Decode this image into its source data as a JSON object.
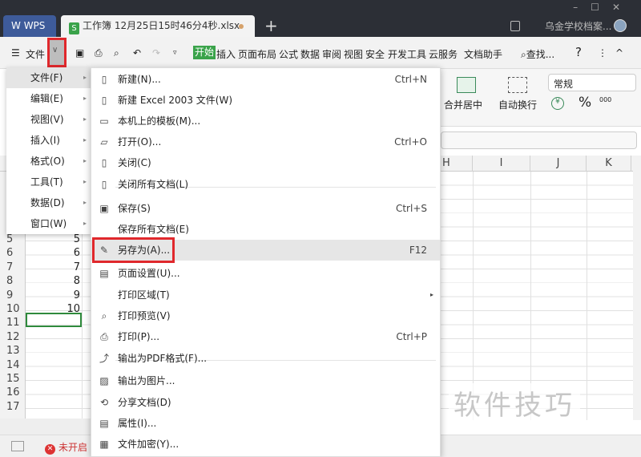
{
  "titlebar": {
    "wps_tab": "WPS",
    "doc_tab": "工作簿 12月25日15时46分4秒.xlsx",
    "doc_icon": "S",
    "user": "乌金学校档案...",
    "window_controls": [
      "–",
      "☐",
      "✕"
    ]
  },
  "toolbar": {
    "menu": "文件",
    "tabs": [
      "开始",
      "插入",
      "页面布局",
      "公式",
      "数据",
      "审阅",
      "视图",
      "安全",
      "开发工具",
      "云服务",
      "文档助手"
    ],
    "search": "查找...",
    "help": "?",
    "more": "⋮",
    "collapse": "^"
  },
  "ribbon": {
    "merge": "合并居中",
    "wrap": "自动换行",
    "format": "常规",
    "percent": "%",
    "thousands": "000"
  },
  "sheet": {
    "columns": [
      "H",
      "I",
      "J",
      "K"
    ],
    "rows": [
      "5",
      "6",
      "7",
      "8",
      "9",
      "10",
      "11",
      "12",
      "13",
      "14",
      "15",
      "16",
      "17"
    ],
    "values": [
      "5",
      "6",
      "7",
      "8",
      "9",
      "10"
    ]
  },
  "status": {
    "warning": "未开启"
  },
  "left_menu": [
    {
      "label": "文件(F)"
    },
    {
      "label": "编辑(E)"
    },
    {
      "label": "视图(V)"
    },
    {
      "label": "插入(I)"
    },
    {
      "label": "格式(O)"
    },
    {
      "label": "工具(T)"
    },
    {
      "label": "数据(D)"
    },
    {
      "label": "窗口(W)"
    }
  ],
  "file_menu": [
    {
      "label": "新建(N)...",
      "shortcut": "Ctrl+N",
      "icon": "new-file"
    },
    {
      "label": "新建 Excel 2003 文件(W)",
      "shortcut": "",
      "icon": "new-file"
    },
    {
      "label": "本机上的模板(M)...",
      "shortcut": "",
      "icon": "template"
    },
    {
      "label": "打开(O)...",
      "shortcut": "Ctrl+O",
      "icon": "folder"
    },
    {
      "label": "关闭(C)",
      "shortcut": "",
      "icon": "close-doc"
    },
    {
      "label": "关闭所有文档(L)",
      "shortcut": "",
      "icon": "close-all"
    },
    {
      "label": "保存(S)",
      "shortcut": "Ctrl+S",
      "icon": "save"
    },
    {
      "label": "保存所有文档(E)",
      "shortcut": "",
      "icon": ""
    },
    {
      "label": "另存为(A)...",
      "shortcut": "F12",
      "icon": "save-as"
    },
    {
      "label": "页面设置(U)...",
      "shortcut": "",
      "icon": "page-setup"
    },
    {
      "label": "打印区域(T)",
      "shortcut": "",
      "icon": ""
    },
    {
      "label": "打印预览(V)",
      "shortcut": "",
      "icon": "print-preview"
    },
    {
      "label": "打印(P)...",
      "shortcut": "Ctrl+P",
      "icon": "print"
    },
    {
      "label": "输出为PDF格式(F)...",
      "shortcut": "",
      "icon": "pdf"
    },
    {
      "label": "输出为图片...",
      "shortcut": "",
      "icon": "image"
    },
    {
      "label": "分享文档(D)",
      "shortcut": "",
      "icon": "share"
    },
    {
      "label": "属性(I)...",
      "shortcut": "",
      "icon": "properties"
    },
    {
      "label": "文件加密(Y)...",
      "shortcut": "",
      "icon": "encrypt"
    }
  ],
  "watermark": "软件技巧"
}
